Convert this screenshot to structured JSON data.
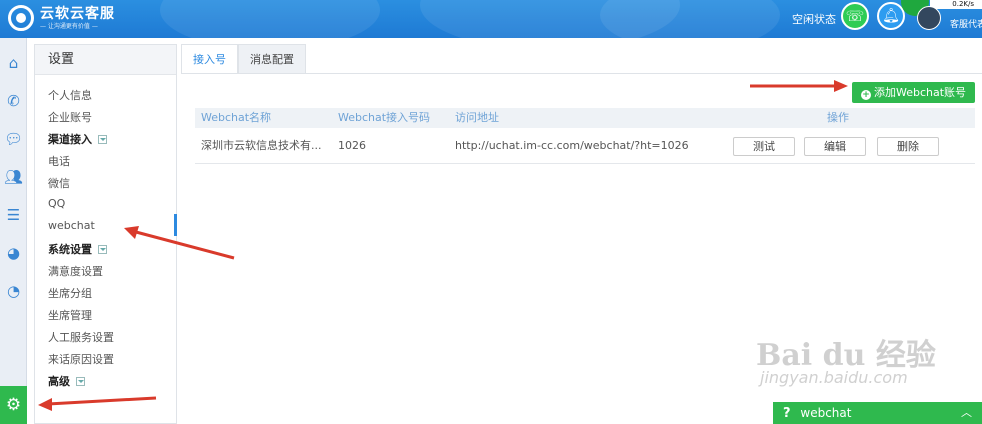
{
  "header": {
    "app_title": "云软云客服",
    "app_subtitle": "— 让沟通更有价值 —",
    "status": "空闲状态",
    "network_speed": "0.2K/s",
    "agent_name": "客服代表"
  },
  "iconbar": {
    "items": [
      "home-icon",
      "phone-icon",
      "chat-icon",
      "users-icon",
      "list-icon",
      "pie-chart-icon",
      "dial-icon"
    ],
    "settings": "gear-icon"
  },
  "nav": {
    "title": "设置",
    "items": [
      {
        "label": "个人信息",
        "group": false
      },
      {
        "label": "企业账号",
        "group": false
      },
      {
        "label": "渠道接入",
        "group": true
      },
      {
        "label": "电话",
        "group": false
      },
      {
        "label": "微信",
        "group": false
      },
      {
        "label": "QQ",
        "group": false
      },
      {
        "label": "webchat",
        "group": false,
        "active": true
      },
      {
        "label": "系统设置",
        "group": true
      },
      {
        "label": "满意度设置",
        "group": false
      },
      {
        "label": "坐席分组",
        "group": false
      },
      {
        "label": "坐席管理",
        "group": false
      },
      {
        "label": "人工服务设置",
        "group": false
      },
      {
        "label": "来话原因设置",
        "group": false
      },
      {
        "label": "高级",
        "group": true
      }
    ]
  },
  "tabs": [
    {
      "label": "接入号",
      "active": true
    },
    {
      "label": "消息配置",
      "active": false
    }
  ],
  "add_button": "添加Webchat账号",
  "table": {
    "headers": [
      "Webchat名称",
      "Webchat接入号码",
      "访问地址",
      "操作"
    ],
    "rows": [
      {
        "name": "深圳市云软信息技术有...",
        "number": "1026",
        "url": "http://uchat.im-cc.com/webchat/?ht=1026",
        "actions": [
          "测试",
          "编辑",
          "删除"
        ]
      }
    ]
  },
  "chat_widget": {
    "icon": "?",
    "label": "webchat",
    "toggle": "︿"
  },
  "watermark": {
    "main": "Bai du 经验",
    "sub": "jingyan.baidu.com"
  },
  "colors": {
    "header_blue": "#1e7ad4",
    "accent_green": "#2fb94e",
    "link_blue": "#2d8ae0",
    "arrow_red": "#d93a2b"
  }
}
